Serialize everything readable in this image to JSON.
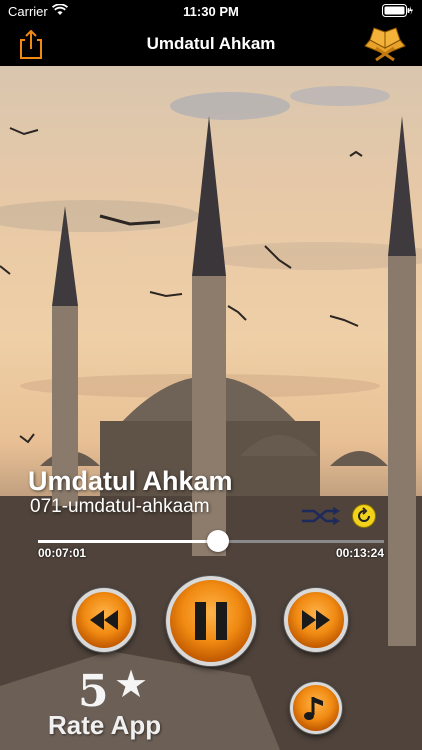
{
  "status_bar": {
    "carrier": "Carrier",
    "time": "11:30 PM",
    "wifi_icon": "wifi-icon",
    "battery_icon": "battery-icon"
  },
  "nav": {
    "title": "Umdatul Ahkam",
    "share_icon": "share-icon",
    "logo_icon": "quran-book-icon"
  },
  "player": {
    "title": "Umdatul Ahkam",
    "subtitle": "071-umdatul-ahkaam",
    "elapsed": "00:07:01",
    "total": "00:13:24",
    "progress": 0.52
  },
  "controls": {
    "rewind_icon": "rewind-icon",
    "pause_icon": "pause-icon",
    "forward_icon": "fast-forward-icon",
    "repeat_icon": "repeat-icon",
    "shuffle_icon": "shuffle-icon",
    "music_icon": "music-note-icon"
  },
  "rate": {
    "number": "5",
    "star": "★",
    "label": "Rate App"
  },
  "colors": {
    "accent": "#f08a12",
    "nav_bg": "#000000",
    "text": "#ffffff"
  }
}
